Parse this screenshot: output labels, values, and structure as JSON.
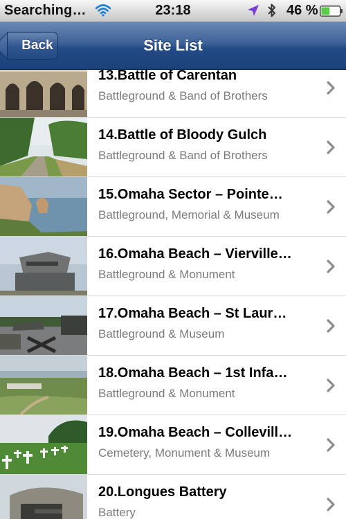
{
  "status_bar": {
    "carrier": "Searching…",
    "time": "23:18",
    "battery": "46 %"
  },
  "nav": {
    "back_label": "Back",
    "title": "Site List"
  },
  "colors": {
    "nav_blue": "#234b86",
    "subtitle_gray": "#7b7b7b",
    "chevron_gray": "#8c8c8c",
    "battery_green": "#5cc94b"
  },
  "sites": [
    {
      "title": "13.Battle of Carentan",
      "subtitle": "Battleground & Band of Brothers",
      "thumb": "church-arches"
    },
    {
      "title": "14.Battle of Bloody Gulch",
      "subtitle": "Battleground & Band of Brothers",
      "thumb": "country-road"
    },
    {
      "title": "15.Omaha Sector – Pointe…",
      "subtitle": "Battleground, Memorial & Museum",
      "thumb": "sea-cliff"
    },
    {
      "title": "16.Omaha Beach – Vierville…",
      "subtitle": "Battleground & Monument",
      "thumb": "bunker-monument"
    },
    {
      "title": "17.Omaha Beach – St Laur…",
      "subtitle": "Battleground & Museum",
      "thumb": "tanks-museum"
    },
    {
      "title": "18.Omaha Beach – 1st Infa…",
      "subtitle": "Battleground & Monument",
      "thumb": "coastal-field"
    },
    {
      "title": "19.Omaha Beach – Collevill…",
      "subtitle": "Cemetery, Monument & Museum",
      "thumb": "cemetery-crosses"
    },
    {
      "title": "20.Longues Battery",
      "subtitle": "Battery",
      "thumb": "gun-battery"
    }
  ]
}
